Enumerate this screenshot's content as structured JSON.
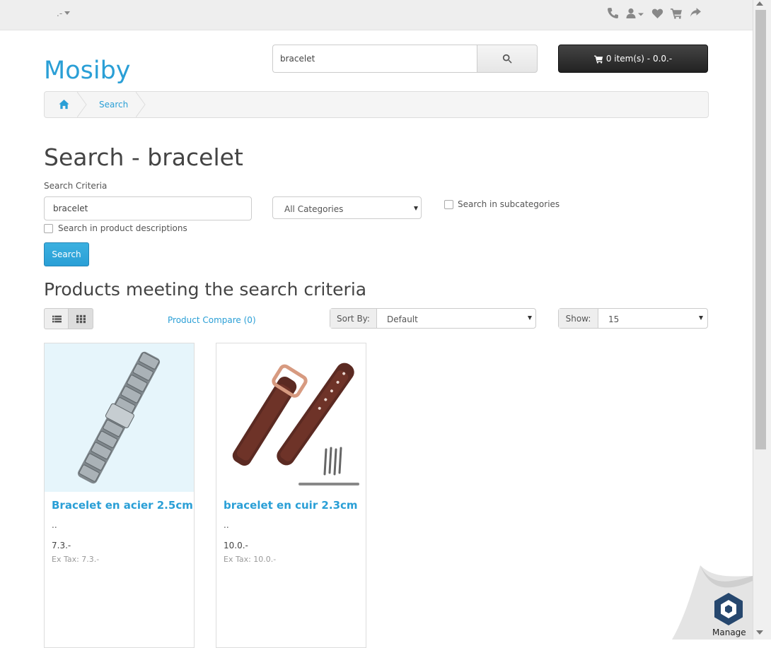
{
  "topbar": {
    "currency_label": ".-",
    "icons": [
      "phone-icon",
      "user-icon",
      "heart-icon",
      "cart-icon",
      "share-icon"
    ]
  },
  "header": {
    "logo": "Mosiby",
    "search_value": "bracelet",
    "cart_label": "0 item(s) - 0.0.-"
  },
  "breadcrumb": {
    "items": [
      "Search"
    ]
  },
  "main": {
    "title": "Search - bracelet",
    "criteria_label": "Search Criteria",
    "keyword_value": "bracelet",
    "category_selected": "All Categories",
    "subcategories_label": "Search in subcategories",
    "descriptions_label": "Search in product descriptions",
    "search_button": "Search",
    "results_title": "Products meeting the search criteria",
    "product_compare": "Product Compare (0)",
    "sort_label": "Sort By:",
    "sort_value": "Default",
    "show_label": "Show:",
    "show_value": "15"
  },
  "products": [
    {
      "name": "Bracelet en acier 2.5cm",
      "desc": "..",
      "price": "7.3.-",
      "tax": "Ex Tax: 7.3.-"
    },
    {
      "name": "bracelet en cuir 2.3cm",
      "desc": "..",
      "price": "10.0.-",
      "tax": "Ex Tax: 10.0.-"
    }
  ],
  "widget": {
    "manage_label": "Manage"
  },
  "colors": {
    "accent": "#2a9fd6",
    "topbar_bg": "#eeeeee",
    "cart_bg": "#222222"
  }
}
